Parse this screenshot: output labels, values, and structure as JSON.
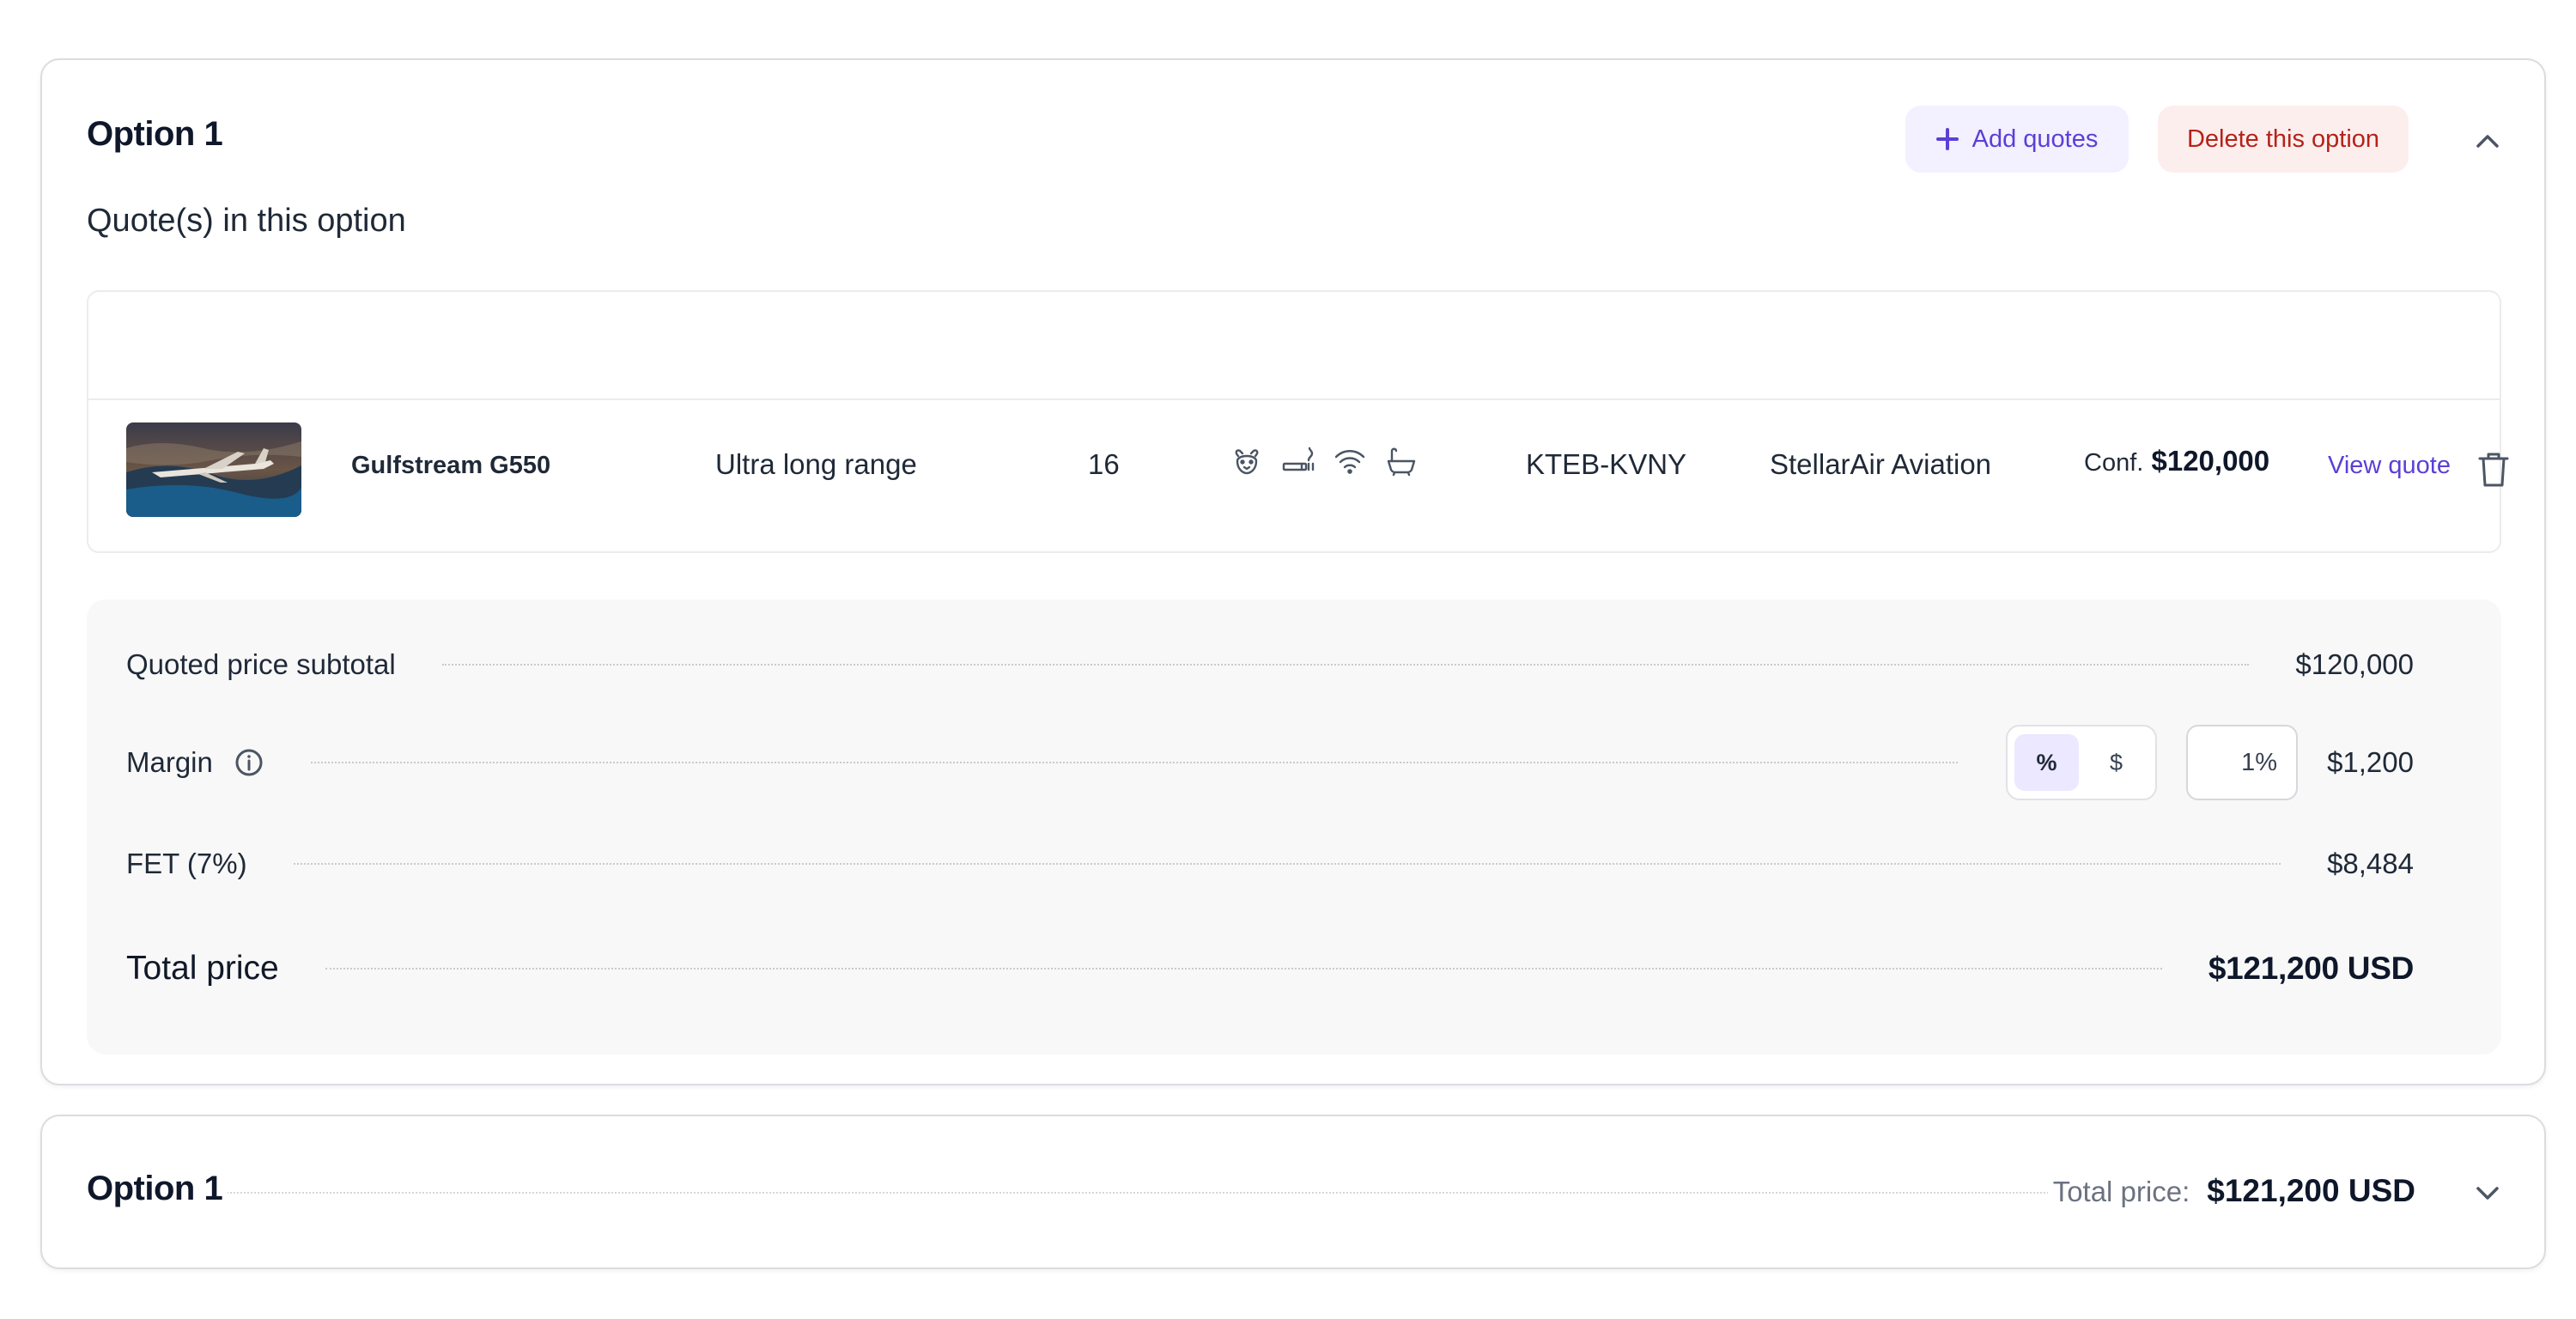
{
  "option_card": {
    "title": "Option 1",
    "add_quotes_label": "Add quotes",
    "delete_label": "Delete this option",
    "subheading": "Quote(s) in this option",
    "quote": {
      "model": "Gulfstream G550",
      "category": "Ultra long range",
      "seats": "16",
      "amenities": [
        "pet-friendly-icon",
        "smoking-icon",
        "wifi-icon",
        "lavatory-icon"
      ],
      "route": "KTEB-KVNY",
      "operator": "StellarAir Aviation",
      "price_label": "Conf.",
      "price_value": "$120,000",
      "view_label": "View quote"
    },
    "summary": {
      "subtotal_label": "Quoted price subtotal",
      "subtotal_value": "$120,000",
      "margin_label": "Margin",
      "margin_toggle_percent": "%",
      "margin_toggle_dollar": "$",
      "margin_input_value": "1%",
      "margin_value": "$1,200",
      "fet_label": "FET (7%)",
      "fet_value": "$8,484",
      "total_label": "Total price",
      "total_value": "$121,200 USD"
    }
  },
  "collapsed_card": {
    "title": "Option 1",
    "total_label": "Total price:",
    "total_value": "$121,200 USD"
  },
  "colors": {
    "accent": "#5b3fd6",
    "accent_bg": "#f3f0ff",
    "danger": "#b42318",
    "danger_bg": "#fdeeee"
  }
}
